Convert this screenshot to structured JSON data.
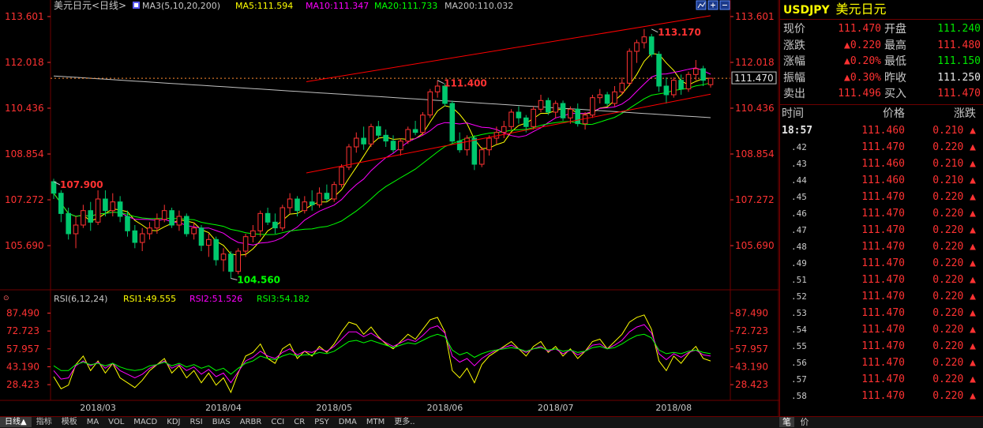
{
  "header": {
    "symbol_name": "美元日元<日线>",
    "ma_label": "MA3(5,10,20,200)",
    "ma5": "MA5:111.594",
    "ma10": "MA10:111.347",
    "ma20": "MA20:111.733",
    "ma200": "MA200:110.032"
  },
  "rsi_header": {
    "label": "RSI(6,12,24)",
    "rsi1": "RSI1:49.555",
    "rsi2": "RSI2:51.526",
    "rsi3": "RSI3:54.182"
  },
  "colors": {
    "up": "#ff3232",
    "down": "#00c86e",
    "ma5": "#ffff00",
    "ma10": "#ff00ff",
    "ma20": "#00ff00",
    "ma200": "#c0c0c0",
    "channel": "#ff0000",
    "rsi1": "#ffff00",
    "rsi2": "#ff00ff",
    "rsi3": "#00ff00"
  },
  "icons": [
    "chart-type-icon",
    "zoom-in-icon",
    "zoom-out-icon"
  ],
  "bottom_tabs": [
    "日线▲",
    "指标",
    "模板",
    "MA",
    "VOL",
    "MACD",
    "KDJ",
    "RSI",
    "BIAS",
    "ARBR",
    "CCI",
    "CR",
    "PSY",
    "DMA",
    "MTM",
    "更多.."
  ],
  "quote_panel": {
    "symbol": "USDJPY",
    "name": "美元日元",
    "rows": [
      {
        "l1": "现价",
        "v1": "111.470",
        "c1": "red",
        "l2": "开盘",
        "v2": "111.240",
        "c2": "grn"
      },
      {
        "l1": "涨跌",
        "v1": "▲0.220",
        "c1": "red",
        "l2": "最高",
        "v2": "111.480",
        "c2": "red"
      },
      {
        "l1": "涨幅",
        "v1": "▲0.20%",
        "c1": "red",
        "l2": "最低",
        "v2": "111.150",
        "c2": "grn"
      },
      {
        "l1": "振幅",
        "v1": "▲0.30%",
        "c1": "red",
        "l2": "昨收",
        "v2": "111.250",
        "c2": "wht"
      },
      {
        "l1": "卖出",
        "v1": "111.496",
        "c1": "red",
        "l2": "买入",
        "v2": "111.470",
        "c2": "red"
      }
    ],
    "table_header": [
      "时间",
      "价格",
      "涨跌"
    ],
    "ticks": [
      {
        "t": "18:57",
        "p": "111.460",
        "c": "0.210"
      },
      {
        "t": ".42",
        "p": "111.470",
        "c": "0.220"
      },
      {
        "t": ".43",
        "p": "111.460",
        "c": "0.210"
      },
      {
        "t": ".44",
        "p": "111.460",
        "c": "0.210"
      },
      {
        "t": ".45",
        "p": "111.470",
        "c": "0.220"
      },
      {
        "t": ".46",
        "p": "111.470",
        "c": "0.220"
      },
      {
        "t": ".47",
        "p": "111.470",
        "c": "0.220"
      },
      {
        "t": ".48",
        "p": "111.470",
        "c": "0.220"
      },
      {
        "t": ".49",
        "p": "111.470",
        "c": "0.220"
      },
      {
        "t": ".51",
        "p": "111.470",
        "c": "0.220"
      },
      {
        "t": ".52",
        "p": "111.470",
        "c": "0.220"
      },
      {
        "t": ".53",
        "p": "111.470",
        "c": "0.220"
      },
      {
        "t": ".54",
        "p": "111.470",
        "c": "0.220"
      },
      {
        "t": ".55",
        "p": "111.470",
        "c": "0.220"
      },
      {
        "t": ".56",
        "p": "111.470",
        "c": "0.220"
      },
      {
        "t": ".57",
        "p": "111.470",
        "c": "0.220"
      },
      {
        "t": ".58",
        "p": "111.470",
        "c": "0.220"
      }
    ],
    "footer": [
      "笔",
      "价"
    ]
  },
  "chart_data": [
    {
      "type": "candlestick",
      "title": "美元日元<日线>",
      "x_labels": [
        "2018/03",
        "2018/04",
        "2018/05",
        "2018/06",
        "2018/07",
        "2018/08"
      ],
      "ylim": [
        104.3,
        113.9
      ],
      "y_ticks": [
        "113.601",
        "112.018",
        "110.436",
        "108.854",
        "107.272",
        "105.690"
      ],
      "annotations": [
        {
          "text": "113.170",
          "value": 113.17,
          "color": "#ff3232"
        },
        {
          "text": "111.400",
          "value": 111.4,
          "color": "#ff3232"
        },
        {
          "text": "107.900",
          "value": 107.9,
          "color": "#ff3232"
        },
        {
          "text": "104.560",
          "value": 104.56,
          "color": "#00ff00"
        }
      ],
      "current_price": "111.470",
      "dotted_price": 111.47,
      "channel_upper": [
        [
          50,
          111.35
        ],
        [
          130,
          113.63
        ]
      ],
      "channel_lower": [
        [
          50,
          108.2
        ],
        [
          130,
          110.92
        ]
      ],
      "ohlc": [
        [
          107.9,
          108.0,
          107.3,
          107.5
        ],
        [
          107.5,
          107.6,
          106.5,
          106.8
        ],
        [
          106.8,
          107.0,
          105.9,
          106.1
        ],
        [
          106.1,
          106.7,
          105.6,
          106.4
        ],
        [
          106.4,
          107.1,
          106.3,
          106.9
        ],
        [
          106.9,
          107.2,
          106.2,
          106.5
        ],
        [
          106.5,
          107.6,
          106.4,
          107.3
        ],
        [
          107.3,
          107.6,
          106.7,
          106.9
        ],
        [
          106.9,
          107.5,
          106.7,
          107.2
        ],
        [
          107.2,
          107.4,
          106.5,
          106.7
        ],
        [
          106.7,
          106.9,
          106.0,
          106.2
        ],
        [
          106.2,
          106.4,
          105.6,
          105.8
        ],
        [
          105.8,
          106.3,
          105.5,
          106.1
        ],
        [
          106.1,
          106.5,
          105.9,
          106.3
        ],
        [
          106.3,
          106.8,
          106.1,
          106.6
        ],
        [
          106.6,
          107.1,
          106.5,
          106.9
        ],
        [
          106.9,
          107.0,
          106.3,
          106.4
        ],
        [
          106.4,
          106.9,
          106.2,
          106.7
        ],
        [
          106.7,
          106.8,
          106.0,
          106.1
        ],
        [
          106.1,
          106.5,
          105.9,
          106.3
        ],
        [
          106.3,
          106.4,
          105.5,
          105.7
        ],
        [
          105.7,
          106.1,
          105.3,
          105.9
        ],
        [
          105.9,
          106.0,
          105.0,
          105.2
        ],
        [
          105.2,
          105.6,
          104.8,
          105.4
        ],
        [
          105.4,
          105.5,
          104.56,
          104.8
        ],
        [
          104.8,
          105.6,
          104.7,
          105.5
        ],
        [
          105.5,
          106.1,
          105.3,
          106.0
        ],
        [
          106.0,
          106.4,
          105.8,
          106.2
        ],
        [
          106.2,
          106.9,
          106.0,
          106.8
        ],
        [
          106.8,
          107.0,
          106.4,
          106.5
        ],
        [
          106.5,
          106.8,
          106.1,
          106.3
        ],
        [
          106.3,
          107.1,
          106.2,
          107.0
        ],
        [
          107.0,
          107.5,
          106.8,
          107.3
        ],
        [
          107.3,
          107.4,
          106.7,
          106.9
        ],
        [
          106.9,
          107.4,
          106.8,
          107.2
        ],
        [
          107.2,
          107.6,
          106.9,
          107.1
        ],
        [
          107.1,
          107.7,
          107.0,
          107.5
        ],
        [
          107.5,
          107.8,
          107.2,
          107.3
        ],
        [
          107.3,
          107.9,
          107.2,
          107.8
        ],
        [
          107.8,
          108.5,
          107.7,
          108.4
        ],
        [
          108.4,
          109.2,
          108.3,
          109.1
        ],
        [
          109.1,
          109.6,
          108.9,
          109.4
        ],
        [
          109.4,
          109.8,
          109.0,
          109.2
        ],
        [
          109.2,
          109.9,
          109.1,
          109.8
        ],
        [
          109.8,
          110.0,
          109.4,
          109.5
        ],
        [
          109.5,
          109.7,
          109.1,
          109.3
        ],
        [
          109.3,
          109.5,
          108.9,
          109.0
        ],
        [
          109.0,
          109.4,
          108.8,
          109.3
        ],
        [
          109.3,
          109.8,
          109.2,
          109.7
        ],
        [
          109.7,
          110.0,
          109.5,
          109.6
        ],
        [
          109.6,
          110.3,
          109.5,
          110.2
        ],
        [
          110.2,
          111.1,
          110.1,
          111.0
        ],
        [
          111.0,
          111.4,
          110.8,
          111.2
        ],
        [
          111.2,
          111.3,
          110.5,
          110.6
        ],
        [
          110.6,
          110.7,
          109.2,
          109.3
        ],
        [
          109.3,
          109.6,
          108.9,
          109.0
        ],
        [
          109.0,
          109.5,
          108.8,
          109.4
        ],
        [
          109.4,
          109.5,
          108.3,
          108.5
        ],
        [
          108.5,
          109.1,
          108.4,
          109.0
        ],
        [
          109.0,
          109.5,
          108.8,
          109.4
        ],
        [
          109.4,
          109.8,
          109.2,
          109.6
        ],
        [
          109.6,
          110.0,
          109.4,
          109.8
        ],
        [
          109.8,
          110.4,
          109.7,
          110.3
        ],
        [
          110.3,
          110.5,
          109.9,
          110.1
        ],
        [
          110.1,
          110.2,
          109.6,
          109.8
        ],
        [
          109.8,
          110.5,
          109.7,
          110.4
        ],
        [
          110.4,
          110.9,
          110.3,
          110.7
        ],
        [
          110.7,
          110.8,
          110.2,
          110.3
        ],
        [
          110.3,
          110.7,
          110.1,
          110.6
        ],
        [
          110.6,
          110.7,
          110.0,
          110.1
        ],
        [
          110.1,
          110.5,
          109.9,
          110.4
        ],
        [
          110.4,
          110.6,
          109.8,
          109.9
        ],
        [
          109.9,
          110.3,
          109.7,
          110.2
        ],
        [
          110.2,
          110.9,
          110.1,
          110.8
        ],
        [
          110.8,
          111.1,
          110.6,
          110.9
        ],
        [
          110.9,
          111.0,
          110.5,
          110.6
        ],
        [
          110.6,
          111.2,
          110.5,
          111.0
        ],
        [
          111.0,
          111.5,
          110.9,
          111.3
        ],
        [
          111.3,
          112.5,
          111.2,
          112.4
        ],
        [
          112.4,
          112.8,
          112.0,
          112.7
        ],
        [
          112.7,
          113.17,
          112.5,
          112.9
        ],
        [
          112.9,
          113.0,
          112.2,
          112.3
        ],
        [
          112.3,
          112.4,
          111.0,
          111.2
        ],
        [
          111.2,
          111.5,
          110.6,
          110.9
        ],
        [
          110.9,
          111.5,
          110.8,
          111.4
        ],
        [
          111.4,
          111.6,
          110.9,
          111.1
        ],
        [
          111.1,
          111.7,
          111.0,
          111.6
        ],
        [
          111.6,
          112.1,
          111.4,
          111.8
        ],
        [
          111.8,
          111.9,
          111.2,
          111.4
        ],
        [
          111.25,
          111.48,
          111.15,
          111.47
        ]
      ]
    },
    {
      "type": "line",
      "title": "RSI(6,12,24)",
      "ylim": [
        20,
        95
      ],
      "y_ticks": [
        "87.490",
        "72.723",
        "57.957",
        "43.190",
        "28.423"
      ],
      "series": [
        {
          "name": "RSI1",
          "values": [
            35,
            25,
            28,
            45,
            52,
            40,
            48,
            38,
            46,
            34,
            30,
            26,
            32,
            40,
            45,
            50,
            38,
            44,
            34,
            40,
            30,
            38,
            28,
            34,
            22,
            38,
            52,
            55,
            62,
            50,
            46,
            58,
            62,
            50,
            56,
            52,
            60,
            55,
            62,
            72,
            80,
            78,
            70,
            76,
            68,
            62,
            58,
            64,
            70,
            66,
            74,
            82,
            84,
            72,
            40,
            34,
            42,
            30,
            45,
            52,
            56,
            60,
            64,
            58,
            52,
            60,
            64,
            55,
            60,
            52,
            58,
            50,
            56,
            64,
            66,
            58,
            64,
            70,
            80,
            84,
            86,
            74,
            48,
            40,
            52,
            46,
            54,
            60,
            50,
            48
          ]
        },
        {
          "name": "RSI2",
          "values": [
            40,
            33,
            34,
            44,
            48,
            44,
            47,
            42,
            46,
            40,
            37,
            34,
            37,
            42,
            45,
            48,
            42,
            45,
            40,
            43,
            37,
            41,
            35,
            38,
            30,
            39,
            48,
            51,
            56,
            52,
            50,
            55,
            58,
            53,
            56,
            55,
            58,
            56,
            60,
            66,
            72,
            72,
            68,
            71,
            67,
            63,
            60,
            63,
            66,
            64,
            69,
            75,
            77,
            71,
            52,
            47,
            50,
            44,
            50,
            54,
            57,
            59,
            61,
            58,
            55,
            58,
            60,
            56,
            58,
            54,
            57,
            53,
            56,
            61,
            62,
            58,
            61,
            65,
            72,
            76,
            78,
            71,
            54,
            49,
            54,
            51,
            55,
            57,
            53,
            52
          ]
        },
        {
          "name": "RSI3",
          "values": [
            44,
            40,
            40,
            45,
            47,
            45,
            46,
            44,
            46,
            43,
            41,
            40,
            41,
            44,
            45,
            47,
            44,
            46,
            43,
            45,
            42,
            44,
            40,
            42,
            37,
            42,
            46,
            48,
            52,
            50,
            49,
            52,
            54,
            52,
            53,
            53,
            55,
            54,
            56,
            60,
            64,
            65,
            63,
            65,
            63,
            61,
            59,
            61,
            63,
            62,
            65,
            68,
            70,
            68,
            57,
            53,
            55,
            51,
            54,
            56,
            57,
            58,
            59,
            58,
            56,
            58,
            59,
            57,
            58,
            56,
            57,
            55,
            56,
            59,
            60,
            58,
            59,
            62,
            66,
            69,
            70,
            67,
            57,
            54,
            55,
            54,
            56,
            57,
            55,
            54
          ]
        }
      ]
    }
  ]
}
